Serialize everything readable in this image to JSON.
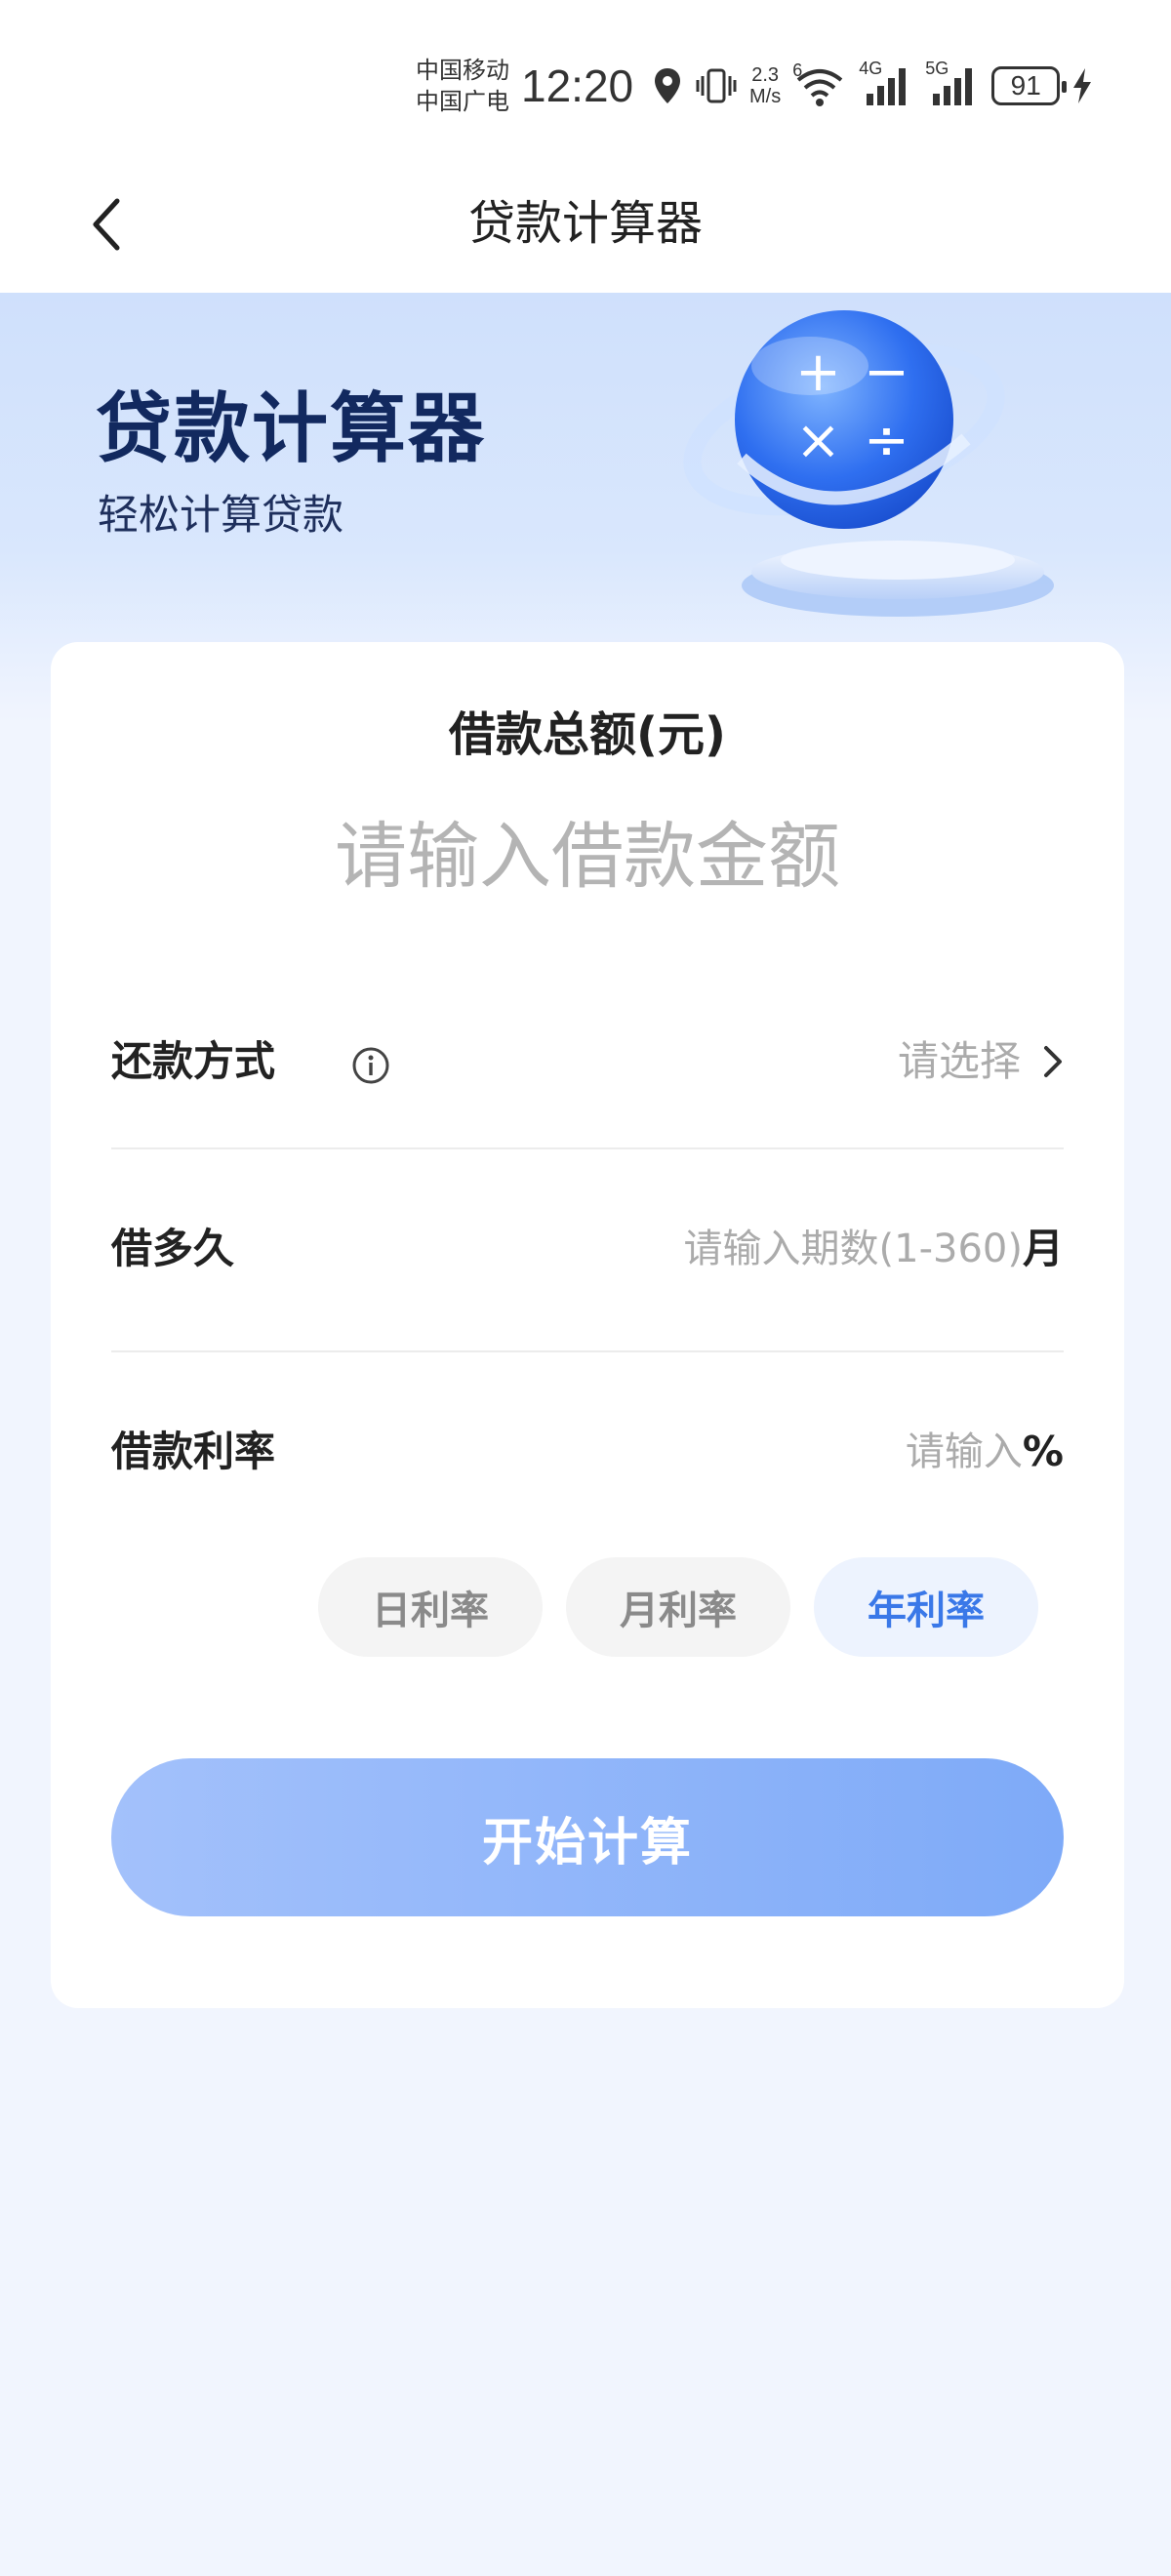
{
  "status_bar": {
    "carrier_1": "中国移动",
    "carrier_2": "中国广电",
    "time": "12:20",
    "net_speed_value": "2.3",
    "net_speed_unit": "M/s",
    "wifi_badge": "6",
    "sim1_type": "4G",
    "sim2_type": "5G",
    "battery": "91"
  },
  "nav": {
    "title": "贷款计算器"
  },
  "hero": {
    "title": "贷款计算器",
    "subtitle": "轻松计算贷款",
    "art_symbols": [
      "+",
      "−",
      "×",
      "÷"
    ]
  },
  "form": {
    "amount_label": "借款总额(元)",
    "amount_placeholder": "请输入借款金额",
    "repay_label": "还款方式",
    "repay_value": "请选择",
    "term_label": "借多久",
    "term_placeholder": "请输入期数(1-360)",
    "term_unit": "月",
    "rate_label": "借款利率",
    "rate_placeholder": "请输入",
    "rate_unit": "%",
    "rate_types": [
      {
        "label": "日利率",
        "active": false
      },
      {
        "label": "月利率",
        "active": false
      },
      {
        "label": "年利率",
        "active": true
      }
    ],
    "submit_label": "开始计算"
  },
  "colors": {
    "accent": "#3a78e8",
    "button_start": "#a3c1fb",
    "button_end": "#7eaaf8",
    "hero_title": "#12295f",
    "page_bg": "#f1f5fe"
  }
}
